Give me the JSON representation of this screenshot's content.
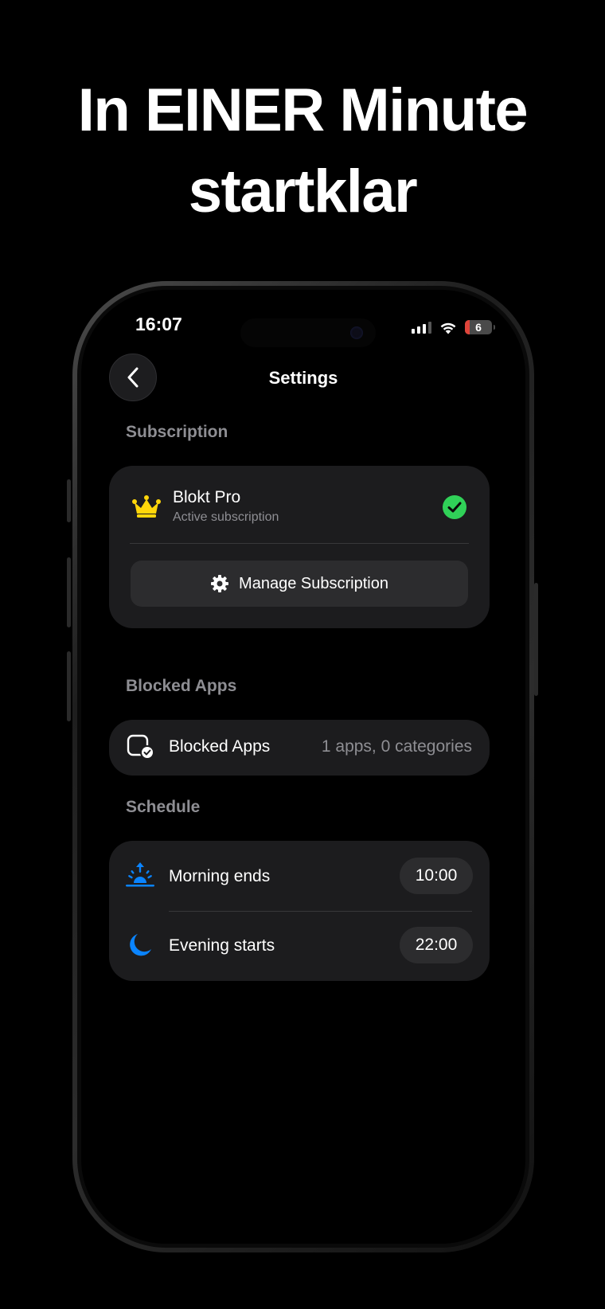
{
  "headline": {
    "line1": "In EINER Minute",
    "line2": "startklar"
  },
  "status_bar": {
    "time": "16:07",
    "battery_level": "6"
  },
  "nav": {
    "title": "Settings",
    "back_icon": "chevron-left-icon"
  },
  "subscription": {
    "section_label": "Subscription",
    "plan_name": "Blokt Pro",
    "plan_status": "Active subscription",
    "manage_label": "Manage Subscription",
    "icons": {
      "plan": "crown-icon",
      "status": "checkmark-circle-icon",
      "manage": "gear-icon"
    },
    "colors": {
      "crown": "#FFD60A",
      "check": "#30D158"
    }
  },
  "blocked_apps": {
    "section_label": "Blocked Apps",
    "row_label": "Blocked Apps",
    "row_value": "1 apps, 0 categories",
    "icon": "app-blocked-icon"
  },
  "schedule": {
    "section_label": "Schedule",
    "items": [
      {
        "label": "Morning ends",
        "time": "10:00",
        "icon": "sunrise-icon"
      },
      {
        "label": "Evening starts",
        "time": "22:00",
        "icon": "moon-icon"
      }
    ],
    "accent_color": "#0A84FF"
  }
}
